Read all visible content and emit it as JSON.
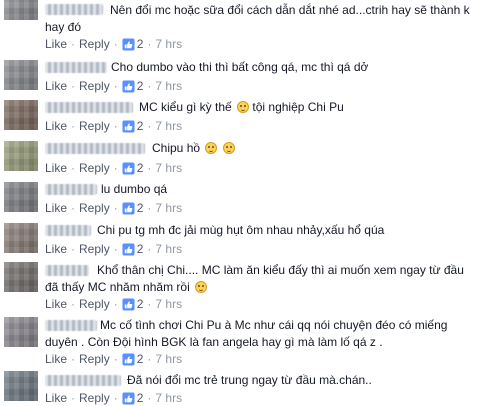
{
  "like_label": "Like",
  "reply_label": "Reply",
  "separator": "·",
  "comments": [
    {
      "text": "Nên đổi mc hoặc sữa đổi cách dẫn dắt nhé ad...ctrih hay sẽ thành k hay đó",
      "likes": "2",
      "time": "7 hrs"
    },
    {
      "text": "Cho dumbo vào thi thì bất công qá, mc thì qá dở",
      "likes": "2",
      "time": "7 hrs"
    },
    {
      "text": "MC kiểu gì kỳ thế",
      "text_after": "tội nghiệp Chi Pu",
      "likes": "2",
      "time": "7 hrs"
    },
    {
      "text": "Chipu hồ",
      "likes": "2",
      "time": "7 hrs"
    },
    {
      "text": "lu dumbo qá",
      "likes": "2",
      "time": "7 hrs"
    },
    {
      "text": "Chi pu tg mh đc jải mùg hụt ôm nhau nhảy,xấu hổ qúa",
      "likes": "2",
      "time": "7 hrs"
    },
    {
      "text": "Khổ thân chị Chi.... MC làm ăn kiểu đấy thì ai muốn xem ngay từ đầu đã thấy MC nhăm nhăm rồi",
      "likes": "2",
      "time": "7 hrs"
    },
    {
      "text": "Mc cố tình chơi Chi Pu à Mc như cái qq nói chuyện đéo có miếng duyên . Còn Đội hình BGK là fan angela hay gì mà làm lố qá z .",
      "likes": "2",
      "time": "7 hrs"
    },
    {
      "text": "Đã nói đổi mc trẻ trung ngay từ đầu mà.chán..",
      "likes": "2",
      "time": "7 hrs"
    }
  ]
}
